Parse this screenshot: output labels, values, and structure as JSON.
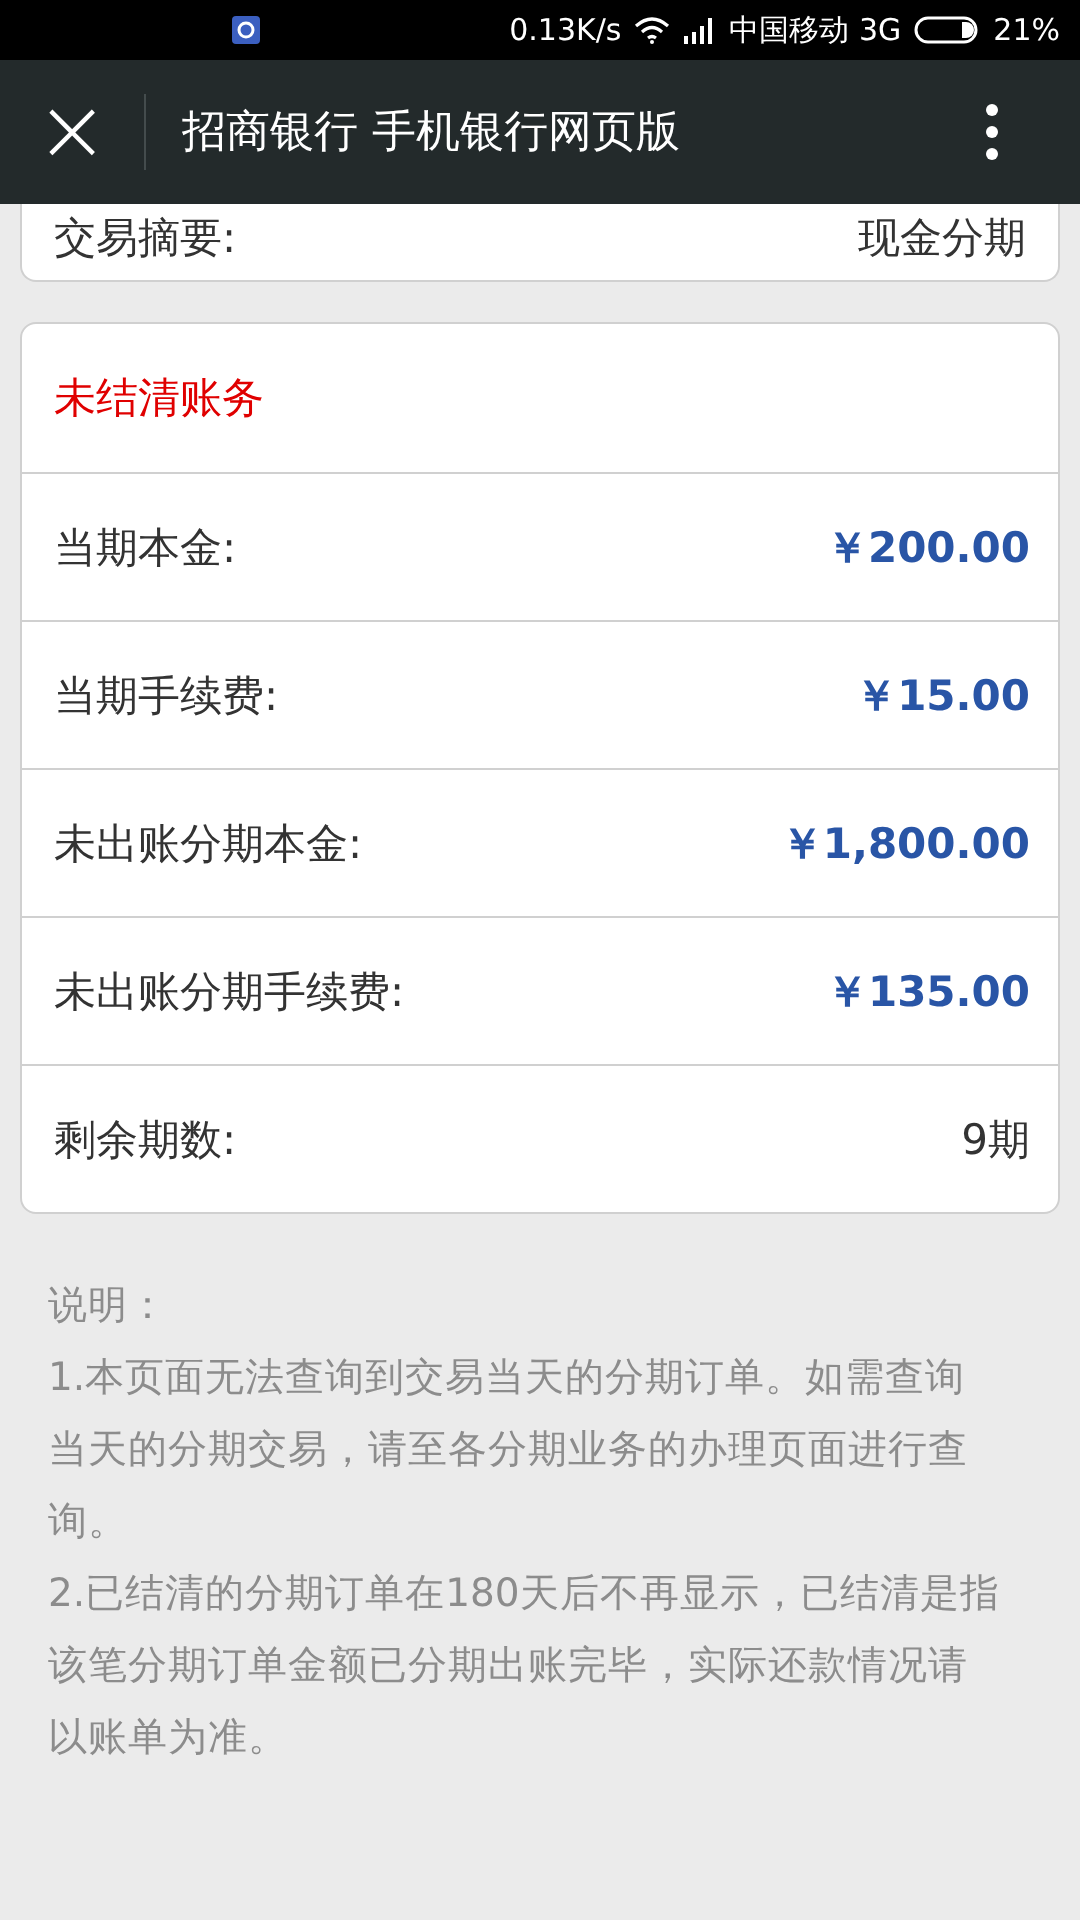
{
  "status_bar": {
    "speed": "0.13K/s",
    "carrier": "中国移动 3G",
    "battery": "21%"
  },
  "header": {
    "close": "×",
    "title": "招商银行 手机银行网页版"
  },
  "summary_row": {
    "label": "交易摘要:",
    "value": "现金分期"
  },
  "card": {
    "title": "未结清账务",
    "rows": [
      {
        "kind": "amount",
        "label": "当期本金:",
        "value": "￥200.00"
      },
      {
        "kind": "amount",
        "label": "当期手续费:",
        "value": "￥15.00"
      },
      {
        "kind": "amount",
        "label": "未出账分期本金:",
        "value": "￥1,800.00"
      },
      {
        "kind": "amount",
        "label": "未出账分期手续费:",
        "value": "￥135.00"
      },
      {
        "kind": "plain",
        "label": "剩余期数:",
        "value": "9期"
      }
    ]
  },
  "notes": [
    "说明：",
    "1.本页面无法查询到交易当天的分期订单。如需查询当天的分期交易，请至各分期业务的办理页面进行查询。",
    "2.已结清的分期订单在180天后不再显示，已结清是指该笔分期订单金额已分期出账完毕，实际还款情况请以账单为准。"
  ]
}
